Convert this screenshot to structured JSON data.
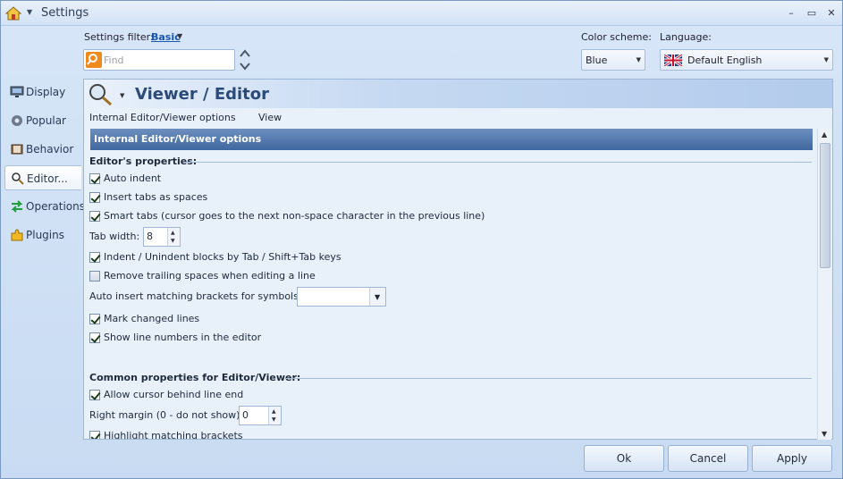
{
  "window": {
    "title": "Settings"
  },
  "filter": {
    "label": "Settings filter:",
    "value": "Basic"
  },
  "search": {
    "placeholder": "Find"
  },
  "color_scheme": {
    "label": "Color scheme:",
    "value": "Blue"
  },
  "language": {
    "label": "Language:",
    "value": "Default English"
  },
  "sidebar": {
    "items": [
      {
        "label": "Display",
        "icon": "monitor-icon"
      },
      {
        "label": "Popular",
        "icon": "gear-icon"
      },
      {
        "label": "Behavior",
        "icon": "book-icon"
      },
      {
        "label": "Editor...",
        "icon": "magnifier-pen-icon",
        "active": true
      },
      {
        "label": "Operations",
        "icon": "arrows-icon"
      },
      {
        "label": "Plugins",
        "icon": "puzzle-icon"
      }
    ]
  },
  "panel": {
    "title": "Viewer / Editor",
    "tabs": [
      "Internal Editor/Viewer options",
      "View"
    ],
    "section_title": "Internal Editor/Viewer options"
  },
  "editor_props": {
    "heading": "Editor's properties:",
    "auto_indent": "Auto indent",
    "tabs_as_spaces": "Insert tabs as spaces",
    "smart_tabs": "Smart tabs (cursor goes to the next non-space character in the previous line)",
    "tab_width_label": "Tab width:",
    "tab_width_value": "8",
    "indent_blocks": "Indent / Unindent blocks by Tab / Shift+Tab keys",
    "remove_trailing": "Remove trailing spaces when editing a line",
    "auto_brackets_label": "Auto insert matching brackets for symbols:",
    "auto_brackets_value": "",
    "mark_changed": "Mark changed lines",
    "show_line_numbers": "Show line numbers in the editor"
  },
  "common_props": {
    "heading": "Common properties for Editor/Viewer:",
    "cursor_behind": "Allow cursor behind line end",
    "right_margin_label": "Right margin (0 - do not show)",
    "right_margin_value": "0",
    "highlight_brackets": "Highlight matching brackets"
  },
  "buttons": {
    "ok": "Ok",
    "cancel": "Cancel",
    "apply": "Apply"
  }
}
